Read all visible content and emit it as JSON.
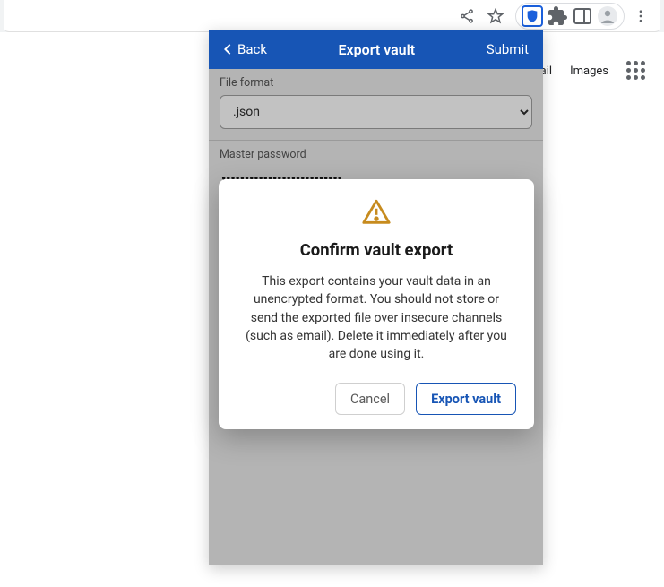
{
  "chrome": {
    "icons": {
      "share": "share-icon",
      "star": "star-icon",
      "bitwarden": "bitwarden-shield-icon",
      "puzzle": "extensions-icon",
      "panel": "side-panel-icon",
      "avatar": "profile-icon",
      "menu": "kebab-menu-icon"
    }
  },
  "google_tabs": {
    "gmail_partial": "ail",
    "images": "Images"
  },
  "extension": {
    "header": {
      "back": "Back",
      "title": "Export vault",
      "submit": "Submit"
    },
    "file_format": {
      "label": "File format",
      "selected": ".json"
    },
    "master_password": {
      "label": "Master password",
      "masked": "••••••••••••••••••••••••••"
    }
  },
  "modal": {
    "title": "Confirm vault export",
    "body": "This export contains your vault data in an unencrypted format. You should not store or send the exported file over insecure channels (such as email). Delete it immediately after you are done using it.",
    "cancel": "Cancel",
    "confirm": "Export vault"
  }
}
